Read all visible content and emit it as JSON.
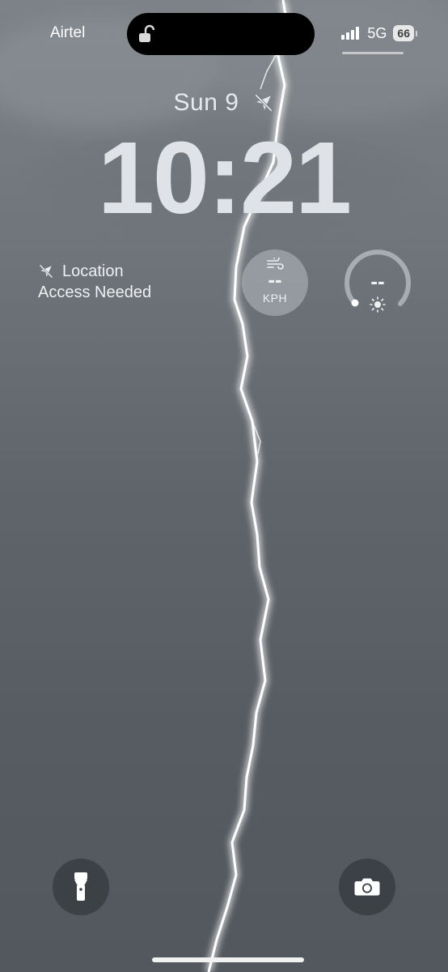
{
  "status_bar": {
    "carrier": "Airtel",
    "network": "5G",
    "battery": "66",
    "lock_icon": "unlocked-padlock-icon",
    "signal_icon": "cellular-signal-icon"
  },
  "lock_screen": {
    "date": "Sun 9",
    "date_icon": "location-unavailable-icon",
    "time": "10:21"
  },
  "widgets": {
    "location": {
      "icon": "location-unavailable-icon",
      "line1": "Location",
      "line2": "Access Needed"
    },
    "wind": {
      "icon": "wind-icon",
      "value": "--",
      "unit": "KPH"
    },
    "uv": {
      "icon": "sun-icon",
      "value": "--"
    }
  },
  "quick_actions": {
    "flashlight_icon": "flashlight-icon",
    "camera_icon": "camera-icon"
  },
  "colors": {
    "wallpaper_top": "#7c8287",
    "wallpaper_bottom": "#52585e",
    "text": "#ffffff",
    "clock": "#dfe3e7",
    "lightning": "#ffffff"
  }
}
